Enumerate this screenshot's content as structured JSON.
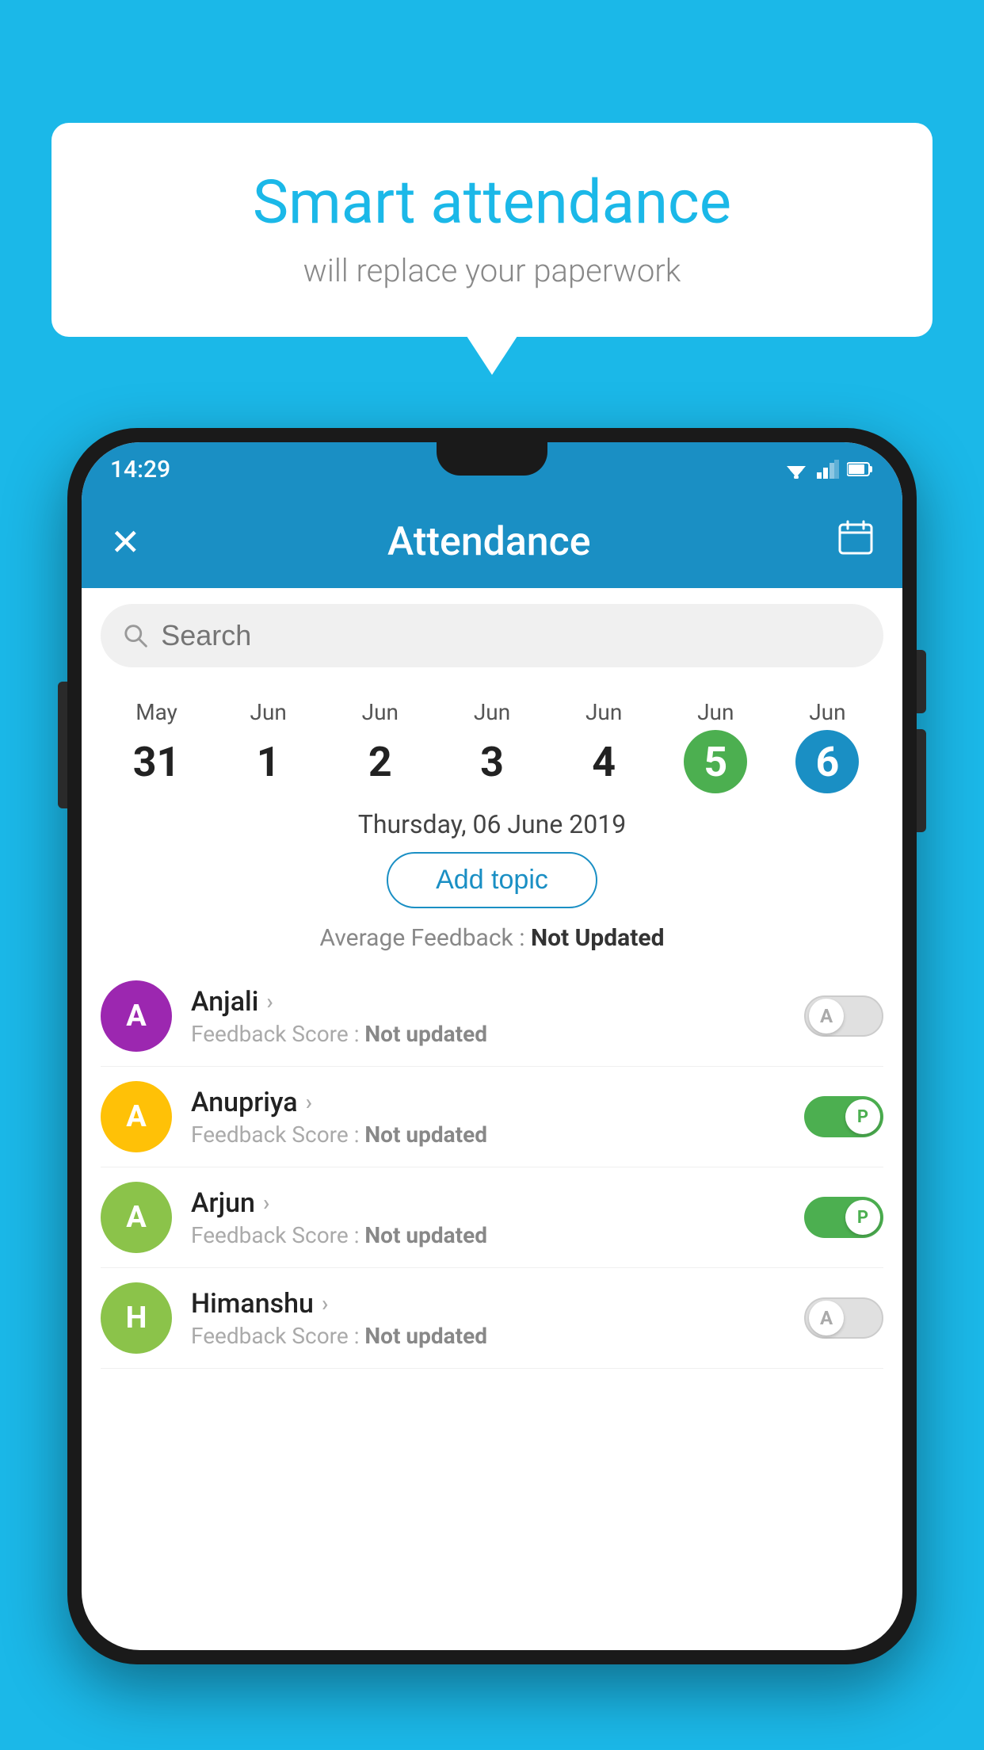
{
  "background_color": "#1BB8E8",
  "bubble": {
    "title": "Smart attendance",
    "subtitle": "will replace your paperwork"
  },
  "status_bar": {
    "time": "14:29"
  },
  "app_bar": {
    "title": "Attendance",
    "close_icon": "✕",
    "calendar_icon": "📅"
  },
  "search": {
    "placeholder": "Search"
  },
  "calendar": {
    "days": [
      {
        "month": "May",
        "date": "31",
        "state": "normal"
      },
      {
        "month": "Jun",
        "date": "1",
        "state": "normal"
      },
      {
        "month": "Jun",
        "date": "2",
        "state": "normal"
      },
      {
        "month": "Jun",
        "date": "3",
        "state": "normal"
      },
      {
        "month": "Jun",
        "date": "4",
        "state": "normal"
      },
      {
        "month": "Jun",
        "date": "5",
        "state": "today"
      },
      {
        "month": "Jun",
        "date": "6",
        "state": "selected"
      }
    ]
  },
  "date_label": "Thursday, 06 June 2019",
  "add_topic_label": "Add topic",
  "avg_feedback_label": "Average Feedback :",
  "avg_feedback_value": "Not Updated",
  "students": [
    {
      "name": "Anjali",
      "avatar_letter": "A",
      "avatar_color": "#9C27B0",
      "feedback_label": "Feedback Score :",
      "feedback_value": "Not updated",
      "toggle_state": "off",
      "toggle_label": "A"
    },
    {
      "name": "Anupriya",
      "avatar_letter": "A",
      "avatar_color": "#FFC107",
      "feedback_label": "Feedback Score :",
      "feedback_value": "Not updated",
      "toggle_state": "on",
      "toggle_label": "P"
    },
    {
      "name": "Arjun",
      "avatar_letter": "A",
      "avatar_color": "#8BC34A",
      "feedback_label": "Feedback Score :",
      "feedback_value": "Not updated",
      "toggle_state": "on",
      "toggle_label": "P"
    },
    {
      "name": "Himanshu",
      "avatar_letter": "H",
      "avatar_color": "#8BC34A",
      "feedback_label": "Feedback Score :",
      "feedback_value": "Not updated",
      "toggle_state": "off",
      "toggle_label": "A"
    }
  ]
}
